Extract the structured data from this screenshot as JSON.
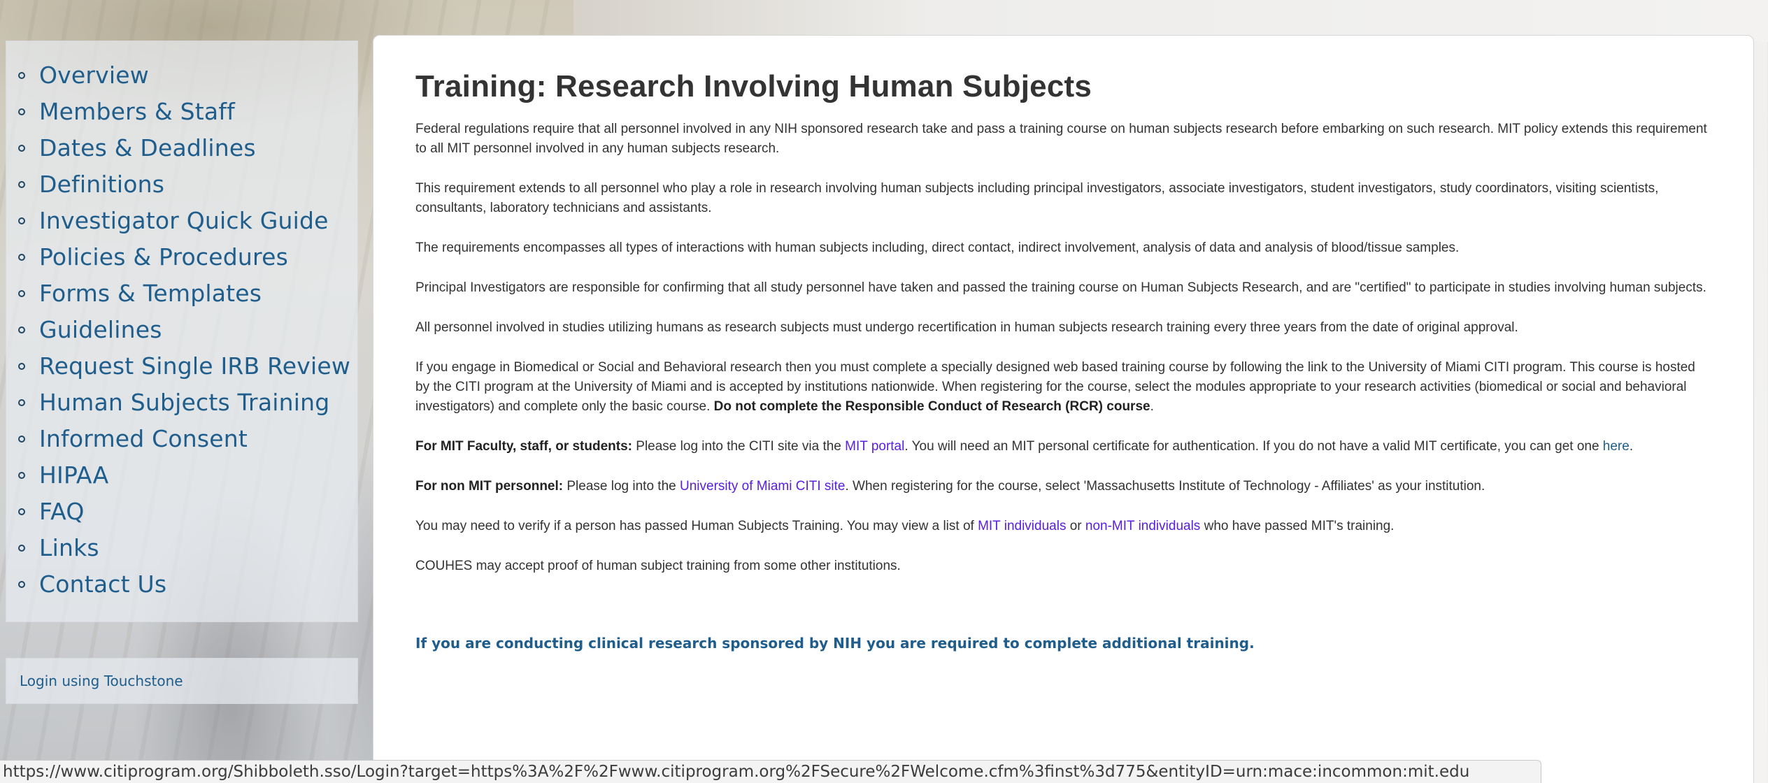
{
  "sidebar": {
    "items": [
      {
        "label": "Overview"
      },
      {
        "label": "Members & Staff"
      },
      {
        "label": "Dates & Deadlines"
      },
      {
        "label": "Definitions"
      },
      {
        "label": "Investigator Quick Guide"
      },
      {
        "label": "Policies & Procedures"
      },
      {
        "label": "Forms & Templates"
      },
      {
        "label": "Guidelines"
      },
      {
        "label": "Request Single IRB Review"
      },
      {
        "label": "Human Subjects Training"
      },
      {
        "label": "Informed Consent"
      },
      {
        "label": "HIPAA"
      },
      {
        "label": "FAQ"
      },
      {
        "label": "Links"
      },
      {
        "label": "Contact Us"
      }
    ],
    "login_label": "Login using Touchstone"
  },
  "main": {
    "title": "Training: Research Involving Human Subjects",
    "p1": "Federal regulations require that all personnel involved in any NIH sponsored research take and pass a training course on human subjects research before embarking on such research. MIT policy extends this requirement to all MIT personnel involved in any human subjects research.",
    "p2": "This requirement extends to all personnel who play a role in research involving human subjects including principal investigators, associate investigators, student investigators, study coordinators, visiting scientists, consultants, laboratory technicians and assistants.",
    "p3": "The requirements encompasses all types of interactions with human subjects including, direct contact, indirect involvement, analysis of data and analysis of blood/tissue samples.",
    "p4": "Principal Investigators are responsible for confirming that all study personnel have taken and passed the training course on Human Subjects Research, and are \"certified\" to participate in studies involving human subjects.",
    "p5": "All personnel involved in studies utilizing humans as research subjects must undergo recertification in human subjects research training every three years from the date of original approval.",
    "p6_text": "If you engage in Biomedical or Social and Behavioral research then you must complete a specially designed web based training course by following the link to the University of Miami CITI program. This course is hosted by the CITI program at the University of Miami and is accepted by institutions nationwide. When registering for the course, select the modules appropriate to your research activities (biomedical or social and behavioral investigators) and complete only the basic course. ",
    "p6_bold": "Do not complete the Responsible Conduct of Research (RCR) course",
    "p6_end": ".",
    "p7_bold": "For MIT Faculty, staff, or students:",
    "p7_a": " Please log into the CITI site via the ",
    "p7_link": "MIT portal",
    "p7_b": ". You will need an MIT personal certificate for authentication. If you do not have a valid MIT certificate, you can get one ",
    "p7_here": "here",
    "p7_end": ".",
    "p8_bold": "For non MIT personnel:",
    "p8_a": " Please log into the ",
    "p8_link": "University of Miami CITI site",
    "p8_b": ". When registering for the course, select 'Massachusetts Institute of Technology - Affiliates' as your institution.",
    "p9_a": "You may need to verify if a person has passed Human Subjects Training. You may view a list of ",
    "p9_link1": "MIT individuals",
    "p9_or": " or ",
    "p9_link2": "non-MIT individuals",
    "p9_b": " who have passed MIT's training.",
    "p10": "COUHES may accept proof of human subject training from some other institutions.",
    "nih_note": "If you are conducting clinical research sponsored by NIH you are required to complete additional training."
  },
  "status_bar": {
    "url": "https://www.citiprogram.org/Shibboleth.sso/Login?target=https%3A%2F%2Fwww.citiprogram.org%2FSecure%2FWelcome.cfm%3finst%3d775&entityID=urn:mace:incommon:mit.edu"
  },
  "colors": {
    "nav_link": "#1f5e8c",
    "body_text": "#333333",
    "link_purple": "#5a1ee0"
  }
}
